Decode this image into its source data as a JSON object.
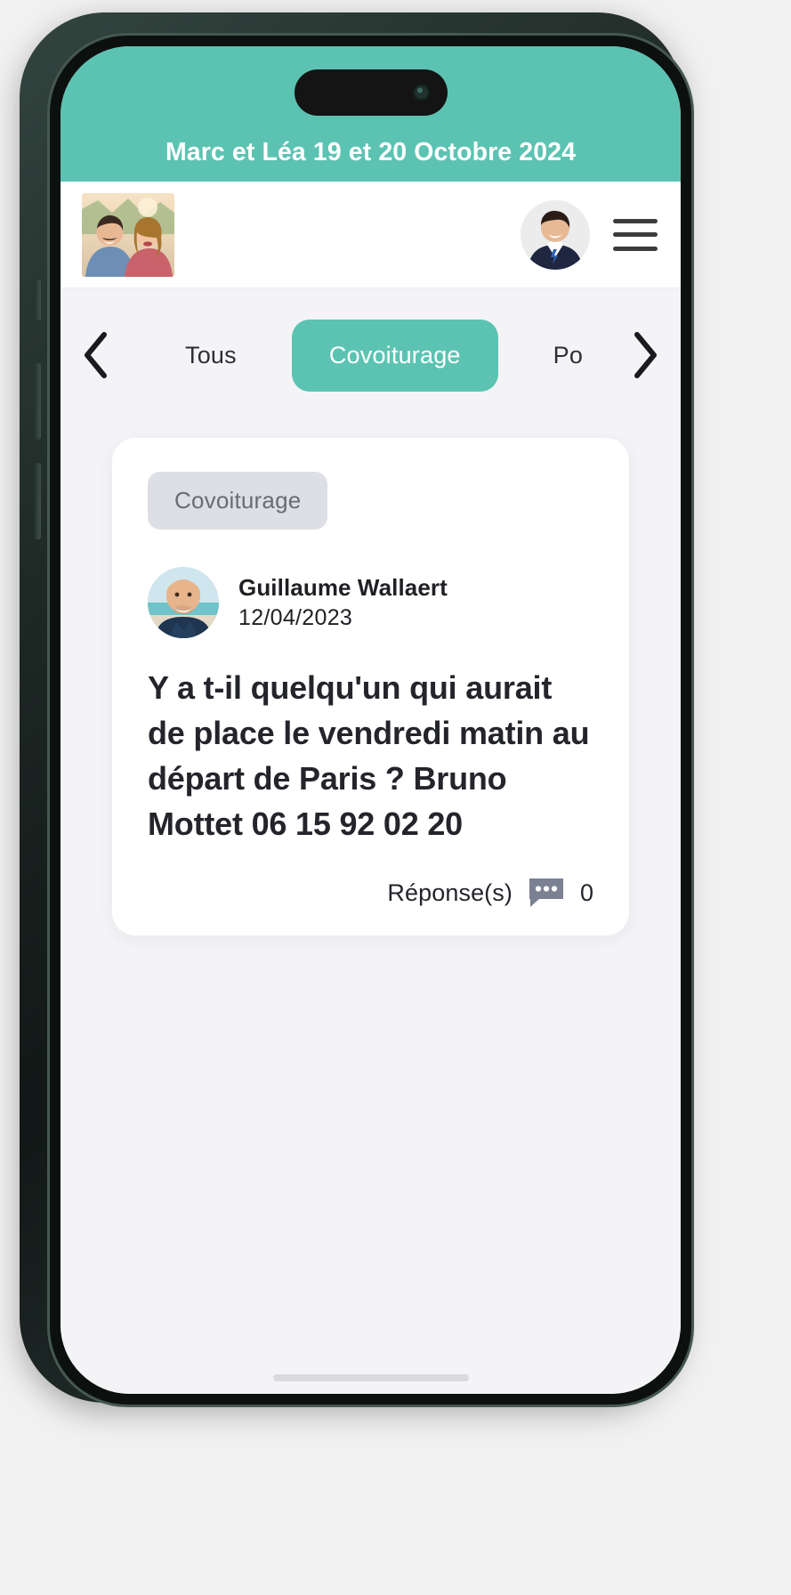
{
  "header": {
    "event_title": "Marc et Léa 19 et 20 Octobre 2024",
    "bg_color": "#5cc3b2",
    "text_color": "#ffffff"
  },
  "navbar": {
    "logo_name": "couple-photo-logo",
    "avatar_name": "user-avatar",
    "menu_label": "menu"
  },
  "tabbar": {
    "prev_arrow": "‹",
    "next_arrow": "›",
    "tabs": [
      {
        "label": "Tous",
        "active": false
      },
      {
        "label": "Covoiturage",
        "active": true
      },
      {
        "label": "Po",
        "active": false
      }
    ],
    "active_color": "#5cc3b2"
  },
  "post": {
    "category": "Covoiturage",
    "author_name": "Guillaume Wallaert",
    "date": "12/04/2023",
    "body": "Y a t-il quelqu'un qui aurait de place le vendredi matin au départ de Paris ? Bruno Mottet 06 15 92 02 20",
    "replies_label": "Réponse(s)",
    "replies_count": "0",
    "badge_bg": "#dedfe4",
    "badge_text_color": "#6b6b74"
  }
}
